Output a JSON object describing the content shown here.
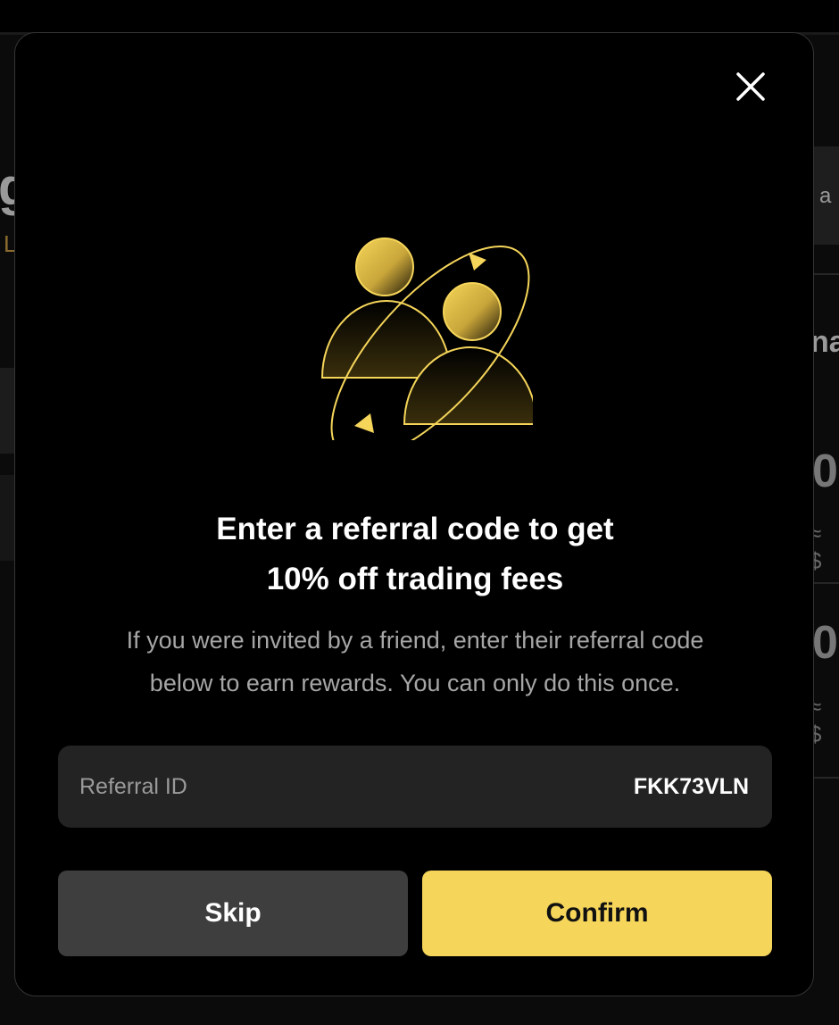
{
  "background": {
    "left_letter": "g",
    "left_sub": "L",
    "right_card_text": "a",
    "right_heading": "na",
    "right_values": [
      "0",
      "0"
    ],
    "right_dollar": [
      "≈ $",
      "≈ $"
    ]
  },
  "modal": {
    "close_icon": "close-icon",
    "illustration_icon": "referral-friends-icon",
    "title_line1": "Enter a referral code to get",
    "title_line2": "10% off trading fees",
    "desc_line1": "If you were invited by a friend, enter their referral code",
    "desc_line2": "below to earn rewards. You can only do this once.",
    "field": {
      "label": "Referral ID",
      "value": "FKK73VLN"
    },
    "skip_label": "Skip",
    "confirm_label": "Confirm"
  },
  "colors": {
    "accent": "#f5d55a",
    "modal_bg": "#000000",
    "field_bg": "#232323",
    "skip_bg": "#3e3e3e"
  }
}
